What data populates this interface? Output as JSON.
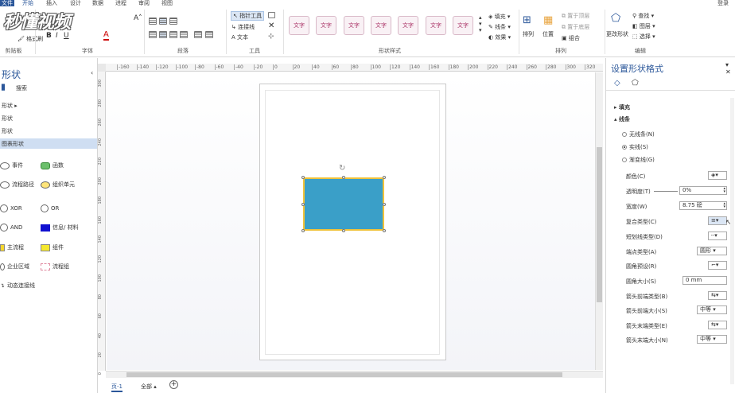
{
  "menu": {
    "file": "文件",
    "tabs": [
      "开始",
      "插入",
      "设计",
      "数据",
      "进程",
      "审阅",
      "视图"
    ],
    "login": "登录"
  },
  "logo": "秒懂视频",
  "ribbon": {
    "clipboard": {
      "format_painter": "格式刷",
      "label": "剪贴板"
    },
    "font": {
      "label": "字体"
    },
    "paragraph": {
      "label": "段落"
    },
    "tools": {
      "pointer": "指针工具",
      "connector": "连接线",
      "text": "文本",
      "label": "工具"
    },
    "shape_styles": {
      "items": [
        "文字",
        "文字",
        "文字",
        "文字",
        "文字",
        "文字",
        "文字"
      ],
      "fill": "填充",
      "line": "线条",
      "effect": "效果",
      "label": "形状样式"
    },
    "arrange": {
      "arrange": "排列",
      "position": "位置",
      "bring_front": "置于顶层",
      "send_back": "置于底层",
      "group": "组合",
      "label": "排列"
    },
    "edit": {
      "change_shape": "更改形状",
      "find": "查找",
      "layer": "图层",
      "select": "选择",
      "label": "编辑"
    }
  },
  "left_panel": {
    "title": "形状",
    "search": "搜索",
    "categories": [
      "形状",
      "形状",
      "形状",
      "图表形状"
    ],
    "shapes": [
      {
        "label": "事件",
        "icon": "oval-icon"
      },
      {
        "label": "函数",
        "icon": "rounded-rect-icon"
      },
      {
        "label": "流程路径",
        "icon": "oval-icon"
      },
      {
        "label": "组织单元",
        "icon": "oval-icon"
      },
      {
        "label": "XOR",
        "icon": "circle-icon"
      },
      {
        "label": "OR",
        "icon": "circle-icon"
      },
      {
        "label": "AND",
        "icon": "circle-icon"
      },
      {
        "label": "信息/ 材料",
        "icon": "square-icon"
      },
      {
        "label": "主流程",
        "icon": "process-icon"
      },
      {
        "label": "组件",
        "icon": "rect-icon"
      },
      {
        "label": "企业区域",
        "icon": "oval-icon"
      },
      {
        "label": "流程组",
        "icon": "rect-icon"
      },
      {
        "label": "动态连接线",
        "icon": "connector-icon"
      }
    ]
  },
  "ruler": {
    "h_ticks": [
      "-160",
      "-140",
      "-120",
      "-100",
      "-80",
      "-60",
      "-40",
      "-20",
      "0",
      "20",
      "40",
      "60",
      "80",
      "100",
      "120",
      "140",
      "160",
      "180",
      "200",
      "220",
      "240",
      "260",
      "280",
      "300",
      "320"
    ],
    "v_ticks": [
      "300",
      "280",
      "260",
      "240",
      "220",
      "200",
      "180",
      "160",
      "140",
      "120",
      "100",
      "80",
      "60",
      "40",
      "20",
      "0"
    ]
  },
  "bottom": {
    "page_tab": "页-1",
    "all": "全部"
  },
  "format_pane": {
    "title": "设置形状格式",
    "fill": "填充",
    "line": "线条",
    "line_options": [
      "无线条(N)",
      "实线(S)",
      "渐变线(G)"
    ],
    "selected_option": 1,
    "rows": [
      {
        "label": "颜色(C)",
        "value": ""
      },
      {
        "label": "透明度(T)",
        "value": "0%"
      },
      {
        "label": "宽度(W)",
        "value": "8.75 磅"
      },
      {
        "label": "复合类型(C)",
        "value": ""
      },
      {
        "label": "短划线类型(D)",
        "value": ""
      },
      {
        "label": "端点类型(A)",
        "value": "圆形"
      },
      {
        "label": "圆角预设(R)",
        "value": ""
      },
      {
        "label": "圆角大小(S)",
        "value": "0 mm"
      },
      {
        "label": "箭头前端类型(B)",
        "value": ""
      },
      {
        "label": "箭头前端大小(S)",
        "value": "中等"
      },
      {
        "label": "箭头末端类型(E)",
        "value": ""
      },
      {
        "label": "箭头末端大小(N)",
        "value": "中等"
      }
    ],
    "colors": {
      "shape_fill": "#3a9fc8",
      "shape_line": "#f0c23a",
      "accent": "#2b579a"
    }
  }
}
